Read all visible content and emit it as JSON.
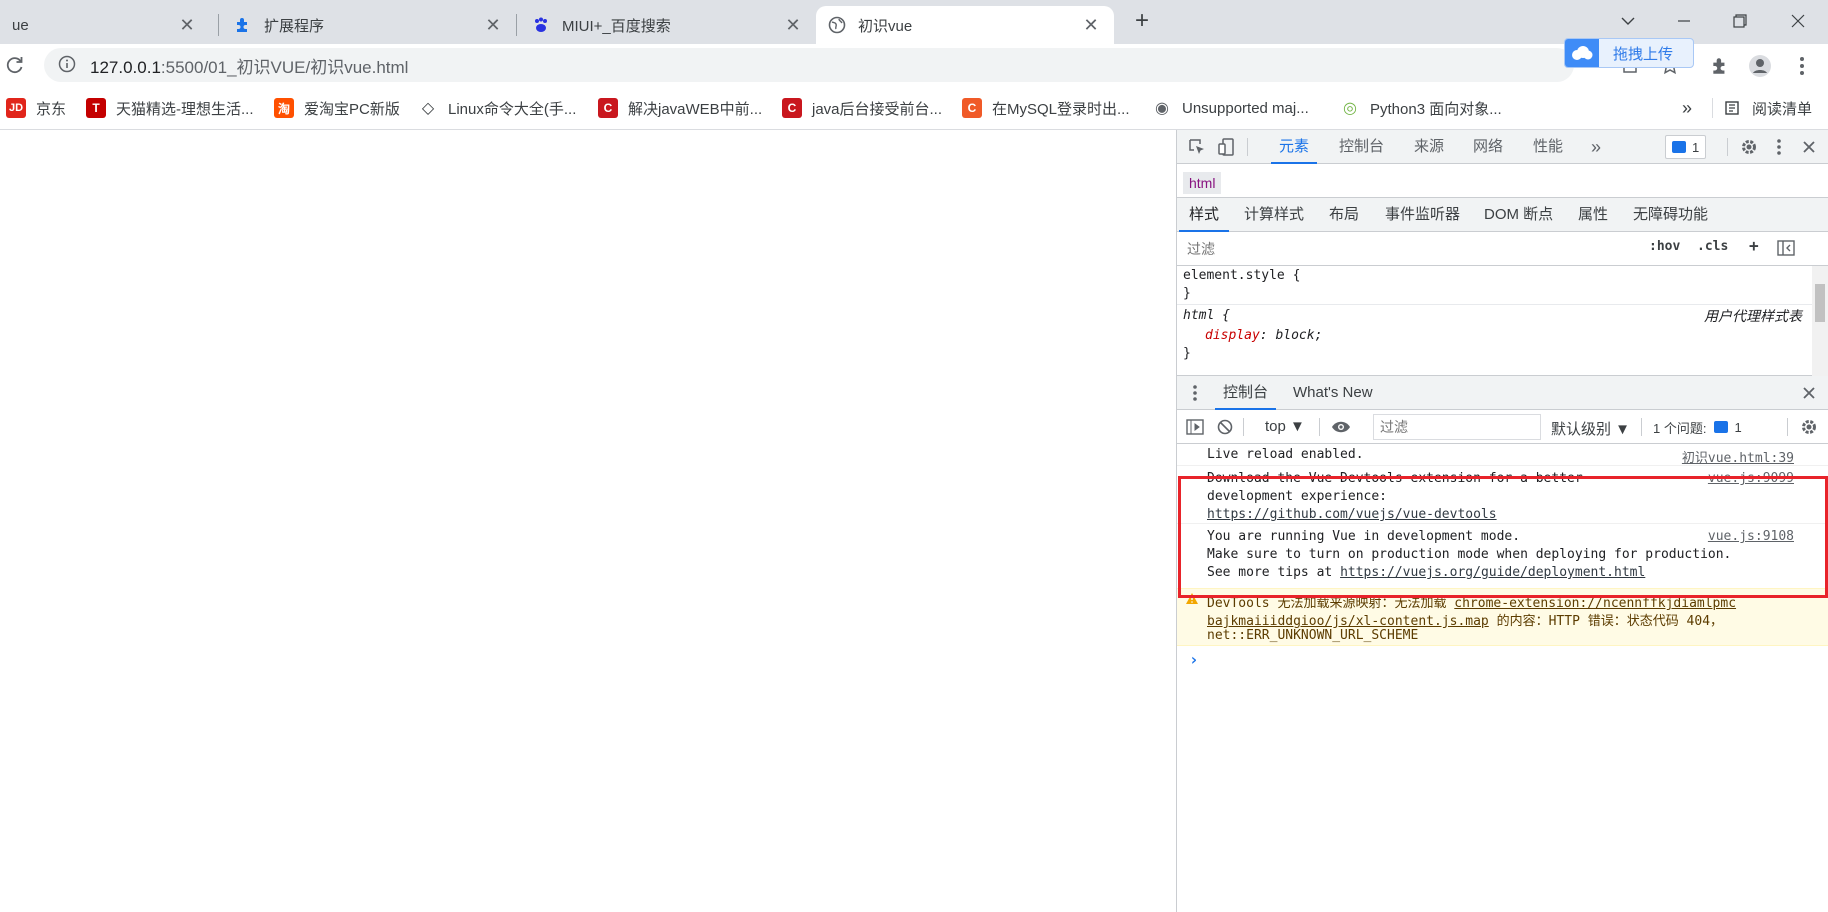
{
  "browser": {
    "tabs": [
      {
        "title": "ue",
        "icon": "vue-icon"
      },
      {
        "title": "扩展程序",
        "icon": "puzzle-icon"
      },
      {
        "title": "MIUI+_百度搜索",
        "icon": "baidu-paw-icon"
      },
      {
        "title": "初识vue",
        "icon": "globe-icon",
        "active": true
      }
    ],
    "new_tab_symbol": "+",
    "window_controls": [
      "chevron-down-icon",
      "minimize-icon",
      "restore-icon",
      "close-icon"
    ]
  },
  "address": {
    "host": "127.0.0.1",
    "path": ":5500/01_初识VUE/初识vue.html"
  },
  "baidu_float": {
    "label": "拖拽上传"
  },
  "bookmarks": [
    {
      "label": "京东",
      "badge": "JD",
      "color": "#e1251b"
    },
    {
      "label": "天猫精选-理想生活...",
      "badge": "T",
      "color": "#c40000"
    },
    {
      "label": "爱淘宝PC新版",
      "badge": "淘",
      "color": "#ff5000"
    },
    {
      "label": "Linux命令大全(手...",
      "badge": "◇",
      "color": "#ffffff"
    },
    {
      "label": "解决javaWEB中前...",
      "badge": "C",
      "color": "#c9171e"
    },
    {
      "label": "java后台接受前台...",
      "badge": "C",
      "color": "#c9171e"
    },
    {
      "label": "在MySQL登录时出...",
      "badge": "C",
      "color": "#f05a28"
    },
    {
      "label": "Unsupported maj...",
      "badge": "◉",
      "color": "#5f6368"
    },
    {
      "label": "Python3 面向对象...",
      "badge": "◎",
      "color": "#74b547"
    }
  ],
  "bookmarks_more": "»",
  "reading_list": "阅读清单",
  "devtools": {
    "main_tabs": [
      "元素",
      "控制台",
      "来源",
      "网络",
      "性能"
    ],
    "more_tabs": "»",
    "issue_count": "1",
    "breadcrumb": "html",
    "style_tabs": [
      "样式",
      "计算样式",
      "布局",
      "事件监听器",
      "DOM 断点",
      "属性",
      "无障碍功能"
    ],
    "styles_filter_placeholder": "过滤",
    "filter_buttons": [
      ":hov",
      ".cls",
      "+"
    ],
    "styles": {
      "element_style_selector": "element.style {",
      "close_brace": "}",
      "html_selector": "html {",
      "ua_label": "用户代理样式表",
      "prop_name": "display",
      "prop_value": ": block;"
    },
    "drawer_tabs": [
      "控制台",
      "What's New"
    ],
    "console_toolbar": {
      "context": "top ▼",
      "filter_placeholder": "过滤",
      "level": "默认级别 ▼",
      "issues_label": "1 个问题:",
      "issues_count": "1"
    },
    "messages": {
      "live_reload": {
        "text": "Live reload enabled.",
        "source": "初识vue.html:39"
      },
      "devtools_ext": {
        "line1": "Download the Vue Devtools extension for a better",
        "line2": "development experience:",
        "link": "https://github.com/vuejs/vue-devtools",
        "source": "vue.js:9099"
      },
      "dev_mode": {
        "line1": "You are running Vue in development mode.",
        "line2": "Make sure to turn on production mode when deploying for production.",
        "line3_prefix": "See more tips at ",
        "link": "https://vuejs.org/guide/deployment.html",
        "source": "vue.js:9108"
      },
      "warning": {
        "line1_prefix": "DevTools 无法加载来源映射：无法加载 ",
        "link1": "chrome-extension://ncennffkjdiamlpmc",
        "link2": "bajkmaiiiddgioo/js/xl-content.js.map",
        "line2_suffix": " 的内容：HTTP 错误：状态代码 404，",
        "line3": "net::ERR_UNKNOWN_URL_SCHEME"
      },
      "prompt": "›"
    }
  }
}
